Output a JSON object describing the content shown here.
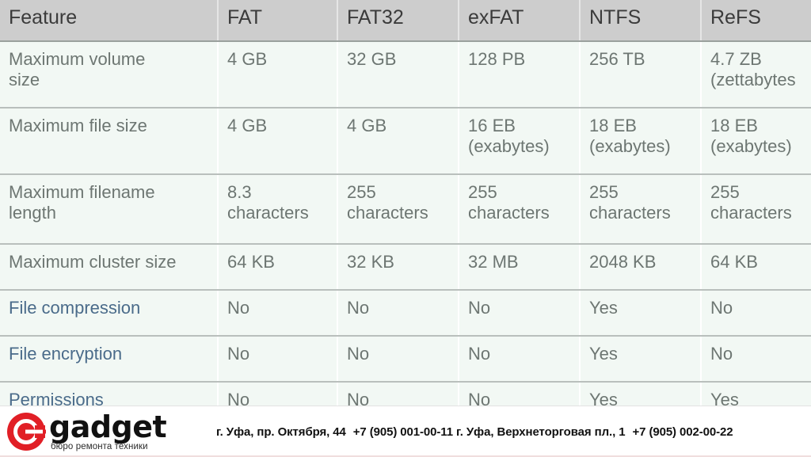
{
  "table": {
    "columns": [
      "Feature",
      "FAT",
      "FAT32",
      "exFAT",
      "NTFS",
      "ReFS"
    ],
    "rows": [
      {
        "feature": "Maximum volume size",
        "feature_line1": "Maximum volume",
        "feature_line2": "size",
        "values": [
          "4 GB",
          "32 GB",
          "128 PB",
          "256 TB",
          "4.7 ZB"
        ],
        "values_line2": [
          "",
          "",
          "",
          "",
          "(zettabytes"
        ],
        "is_link": false
      },
      {
        "feature": "Maximum file size",
        "feature_line1": "Maximum file size",
        "feature_line2": "",
        "values": [
          "4 GB",
          "4 GB",
          "16 EB",
          "18 EB",
          "18 EB"
        ],
        "values_line2": [
          "",
          "",
          "(exabytes)",
          "(exabytes)",
          "(exabytes)"
        ],
        "is_link": false
      },
      {
        "feature": "Maximum filename length",
        "feature_line1": "Maximum filename",
        "feature_line2": "length",
        "values": [
          "8.3",
          "255",
          "255",
          "255",
          "255"
        ],
        "values_line2": [
          "characters",
          "characters",
          "characters",
          "characters",
          "characters"
        ],
        "is_link": false
      },
      {
        "feature": "Maximum cluster size",
        "feature_line1": "Maximum cluster size",
        "feature_line2": "",
        "values": [
          "64 KB",
          "32 KB",
          "32 MB",
          "2048 KB",
          "64 KB"
        ],
        "values_line2": [
          "",
          "",
          "",
          "",
          ""
        ],
        "is_link": false
      },
      {
        "feature": "File compression",
        "feature_line1": "File compression",
        "feature_line2": "",
        "values": [
          "No",
          "No",
          "No",
          "Yes",
          "No"
        ],
        "values_line2": [
          "",
          "",
          "",
          "",
          ""
        ],
        "is_link": true
      },
      {
        "feature": "File encryption",
        "feature_line1": "File encryption",
        "feature_line2": "",
        "values": [
          "No",
          "No",
          "No",
          "Yes",
          "No"
        ],
        "values_line2": [
          "",
          "",
          "",
          "",
          ""
        ],
        "is_link": true
      },
      {
        "feature": "Permissions",
        "feature_line1": "Permissions",
        "feature_line2": "",
        "values": [
          "No",
          "No",
          "No",
          "Yes",
          "Yes"
        ],
        "values_line2": [
          "",
          "",
          "",
          "",
          ""
        ],
        "is_link": true
      }
    ]
  },
  "banner": {
    "logo_word": "gadget",
    "logo_tagline": "бюро ремонта техники",
    "logo_icon": "gadget-c-mark-icon",
    "logo_color": "#e11f26",
    "contacts_address_1": "г. Уфа, пр. Октября, 44",
    "contacts_phone_1": "+7 (905) 001-00-11",
    "contacts_address_2": "г. Уфа, Верхнеторговая пл., 1",
    "contacts_phone_2": "+7 (905) 002-00-22"
  }
}
